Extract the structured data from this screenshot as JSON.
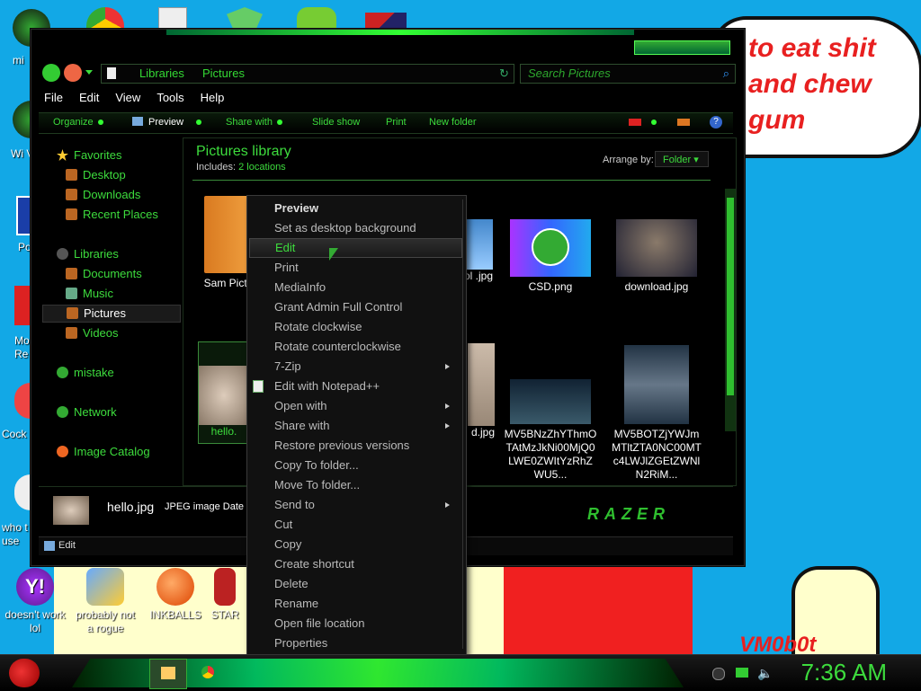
{
  "speech_bubble": {
    "text": "to eat shit and chew gum"
  },
  "signature": "VM0b0t",
  "desktop_icons": [
    {
      "label": "mi"
    },
    {
      "label": "Wi V"
    },
    {
      "label": "Po"
    },
    {
      "label": "Mo Re"
    },
    {
      "label": "Cock"
    },
    {
      "label": "who t use"
    }
  ],
  "desktop_bottom_icons": [
    {
      "label": "doesn't work lol"
    },
    {
      "label": "probably not a rogue"
    },
    {
      "label": "INKBALLS"
    },
    {
      "label": "STAR"
    }
  ],
  "explorer": {
    "breadcrumb": [
      "Libraries",
      "Pictures"
    ],
    "search_placeholder": "Search Pictures",
    "menu": [
      "File",
      "Edit",
      "View",
      "Tools",
      "Help"
    ],
    "toolbar": [
      "Organize",
      "Preview",
      "Share with",
      "Slide show",
      "Print",
      "New folder"
    ],
    "sidebar": {
      "favorites_label": "Favorites",
      "favorites": [
        "Desktop",
        "Downloads",
        "Recent Places"
      ],
      "libraries_label": "Libraries",
      "libraries": [
        "Documents",
        "Music",
        "Pictures",
        "Videos"
      ],
      "mistake": "mistake",
      "network": "Network",
      "image_catalog": "Image Catalog"
    },
    "library": {
      "title": "Pictures library",
      "includes_label": "Includes:",
      "includes_value": "2 locations",
      "arrange_label": "Arrange by:",
      "arrange_value": "Folder"
    },
    "files": [
      {
        "name": "Sam Pictu"
      },
      {
        "name": "tofdol .jpg"
      },
      {
        "name": "CSD.png"
      },
      {
        "name": "download.jpg"
      },
      {
        "name": "hello."
      },
      {
        "name": "d.jpg"
      },
      {
        "name": "MV5BNzZhYThmOTAtMzJkNi00MjQ0LWE0ZWItYzRhZWU5..."
      },
      {
        "name": "MV5BOTZjYWJmMTltZTA0NC00MTc4LWJlZGEtZWNlN2RiM..."
      }
    ],
    "details": {
      "filename": "hello.jpg",
      "meta": "JPEG image  Date tak"
    },
    "status": "Edit",
    "brand": "RAZER"
  },
  "context_menu": [
    {
      "label": "Preview",
      "bold": true
    },
    {
      "label": "Set as desktop background"
    },
    {
      "label": "Edit",
      "highlight": true
    },
    {
      "label": "Print"
    },
    {
      "label": "MediaInfo"
    },
    {
      "label": "Grant Admin Full Control"
    },
    {
      "label": "Rotate clockwise"
    },
    {
      "label": "Rotate counterclockwise"
    },
    {
      "label": "7-Zip",
      "submenu": true
    },
    {
      "label": "Edit with Notepad++",
      "icon": true
    },
    {
      "label": "Open with",
      "submenu": true
    },
    {
      "label": "Share with",
      "submenu": true
    },
    {
      "label": "Restore previous versions"
    },
    {
      "label": "Copy To folder..."
    },
    {
      "label": "Move To folder..."
    },
    {
      "label": "Send to",
      "submenu": true
    },
    {
      "label": "Cut"
    },
    {
      "label": "Copy"
    },
    {
      "label": "Create shortcut"
    },
    {
      "label": "Delete"
    },
    {
      "label": "Rename"
    },
    {
      "label": "Open file location"
    },
    {
      "label": "Properties"
    }
  ],
  "taskbar": {
    "clock": "7:36 AM"
  },
  "colors": {
    "accent": "#3ddc3d",
    "desktop": "#12a8e6",
    "bubble_text": "#e82020"
  }
}
